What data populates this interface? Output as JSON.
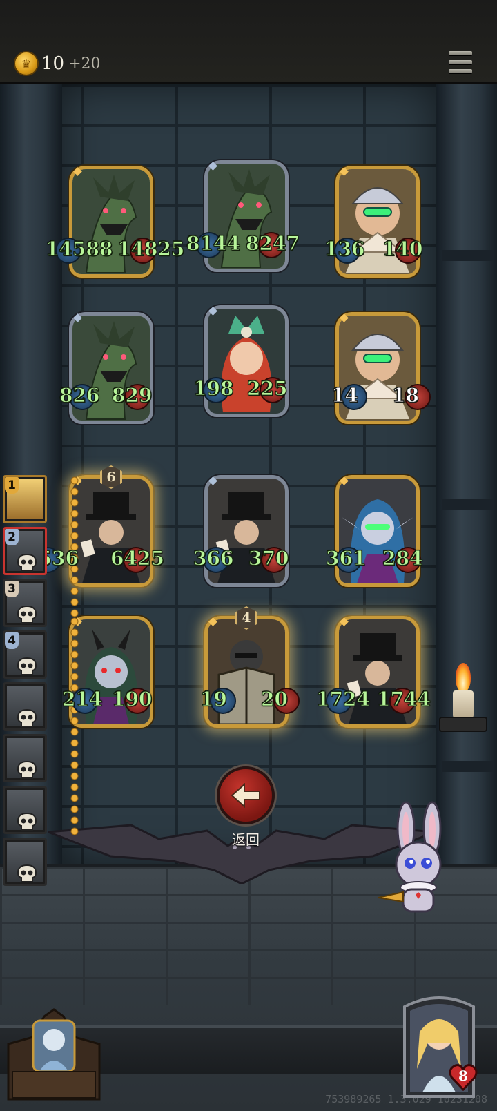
{
  "currency": {
    "coins": "10",
    "bonus": "+20",
    "icon": "crown-coin-icon"
  },
  "menu": {
    "icon": "hamburger-menu-icon"
  },
  "board": {
    "cards": [
      {
        "id": "dragon-1",
        "portrait": "green-dragon",
        "frame": "gold",
        "attack": "14588",
        "hp": "14825",
        "badge": "purple-claw"
      },
      {
        "id": "dragon-2",
        "portrait": "green-dragon",
        "frame": "silver",
        "attack": "8144",
        "hp": "8247",
        "badge": "purple-claw"
      },
      {
        "id": "granny-1",
        "portrait": "fan-granny",
        "frame": "gold",
        "attack": "136",
        "hp": "140"
      },
      {
        "id": "dragon-3",
        "portrait": "green-dragon",
        "frame": "silver",
        "attack": "826",
        "hp": "829",
        "badge": "red-hp"
      },
      {
        "id": "siren",
        "portrait": "red-hair-siren",
        "frame": "silver",
        "attack": "198",
        "hp": "225"
      },
      {
        "id": "granny-2",
        "portrait": "fan-granny",
        "frame": "gold",
        "attack": "14",
        "hp": "18",
        "statColor": "white"
      },
      {
        "id": "magician-1",
        "portrait": "top-hat-magician",
        "frame": "gold",
        "attack": "5536",
        "hp": "6425",
        "level": "6",
        "glow": true
      },
      {
        "id": "magician-2",
        "portrait": "top-hat-magician",
        "frame": "silver",
        "attack": "366",
        "hp": "370"
      },
      {
        "id": "elf",
        "portrait": "blue-hair-elf",
        "frame": "gold",
        "attack": "361",
        "hp": "284"
      },
      {
        "id": "demon",
        "portrait": "horned-demon-girl",
        "frame": "gold",
        "attack": "214",
        "hp": "190"
      },
      {
        "id": "knight",
        "portrait": "shield-knight",
        "frame": "gold",
        "attack": "19",
        "hp": "20",
        "level": "4",
        "glow": true
      },
      {
        "id": "magician-3",
        "portrait": "top-hat-magician",
        "frame": "gold",
        "attack": "1724",
        "hp": "1744",
        "glow": true
      }
    ]
  },
  "turn_order": [
    {
      "position": "1",
      "portrait": "blonde-hero"
    },
    {
      "position": "2",
      "portrait": "cat-skull"
    },
    {
      "position": "3",
      "portrait": "top-hat-skull"
    },
    {
      "position": "4",
      "portrait": "masked-skull"
    },
    {
      "position": "",
      "portrait": "skull"
    },
    {
      "position": "",
      "portrait": "skull"
    },
    {
      "position": "",
      "portrait": "skull"
    },
    {
      "position": "",
      "portrait": "skull"
    }
  ],
  "back": {
    "label": "返回",
    "icon": "arrow-left-icon"
  },
  "opponent": {
    "hp": "8",
    "icon": "heart-icon"
  },
  "watermark": "753989265 1.3.029 10231208",
  "colors": {
    "stat_text": "#b8f59a",
    "gold_frame": "#c89a3a",
    "silver_frame": "#7e8796",
    "back_button": "#c4342c"
  }
}
